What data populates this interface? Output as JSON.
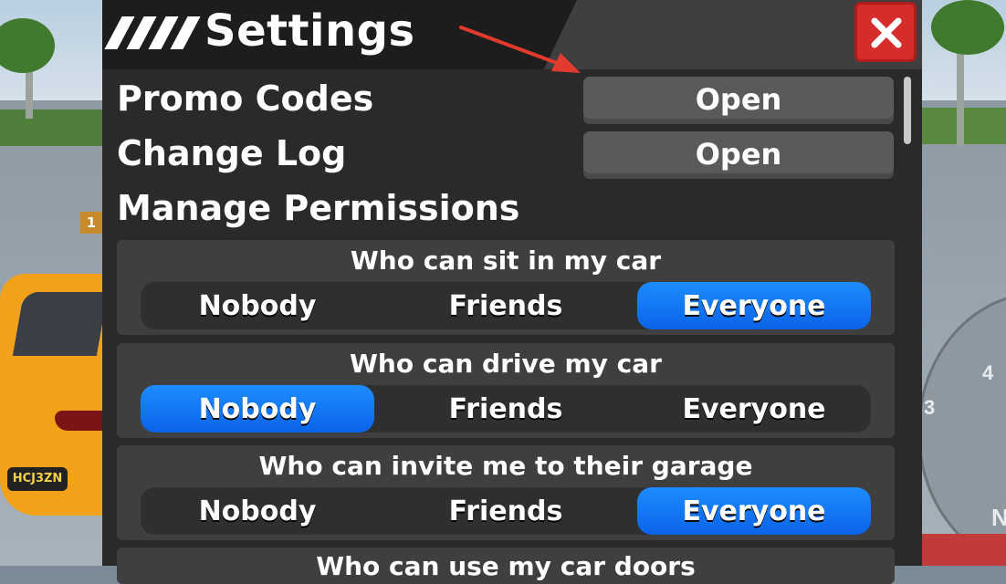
{
  "background": {
    "sign_number": "1",
    "plate_text": "HCJ3ZN",
    "gauge_numbers": [
      "3",
      "4"
    ],
    "edge_letter": "N"
  },
  "settings": {
    "title": "Settings",
    "close_icon": "close-icon",
    "rows": [
      {
        "label": "Promo Codes",
        "button": "Open"
      },
      {
        "label": "Change Log",
        "button": "Open"
      }
    ],
    "section_title": "Manage Permissions",
    "permissions": [
      {
        "question": "Who can sit in my car",
        "options": [
          "Nobody",
          "Friends",
          "Everyone"
        ],
        "selected": "Everyone"
      },
      {
        "question": "Who can drive my car",
        "options": [
          "Nobody",
          "Friends",
          "Everyone"
        ],
        "selected": "Nobody"
      },
      {
        "question": "Who can invite me to their garage",
        "options": [
          "Nobody",
          "Friends",
          "Everyone"
        ],
        "selected": "Everyone"
      },
      {
        "question": "Who can use my car doors",
        "options": [],
        "selected": ""
      }
    ]
  },
  "colors": {
    "panel": "#2a2a2a",
    "selected_option": "#1d8cff",
    "close_button": "#d52c2c",
    "annotation_arrow": "#e23b2e"
  }
}
